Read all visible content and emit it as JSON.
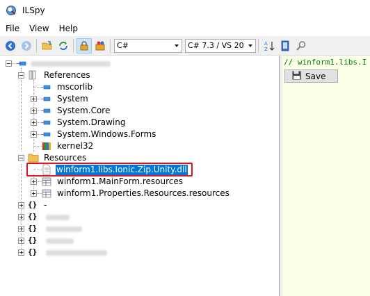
{
  "window": {
    "title": "ILSpy",
    "icon": "ilspy-logo-icon"
  },
  "menu": {
    "items": [
      "File",
      "View",
      "Help"
    ]
  },
  "toolbar": {
    "language": "C#",
    "version": "C# 7.3 / VS 20",
    "icons": [
      "back-icon",
      "forward-icon",
      "open-folder-icon",
      "refresh-icon",
      "lock-icon",
      "show-all-icon",
      "sort-icon",
      "bookmark-icon",
      "search-icon"
    ]
  },
  "tree": {
    "root_label": "",
    "references": {
      "label": "References",
      "items": [
        "mscorlib",
        "System",
        "System.Core",
        "System.Drawing",
        "System.Windows.Forms",
        "kernel32"
      ]
    },
    "resources": {
      "label": "Resources",
      "items": [
        "winform1.libs.Ionic.Zip.Unity.dll",
        "winform1.MainForm.resources",
        "winform1.Properties.Resources.resources"
      ]
    },
    "namespaces": [
      "-",
      "",
      "",
      "",
      ""
    ]
  },
  "editor": {
    "code": "// winform1.libs.I",
    "save_label": "Save"
  },
  "colors": {
    "selection": "#0078d7",
    "highlight_box": "#e0141e",
    "editor_bg": "#fbffe8",
    "comment": "#008000"
  }
}
